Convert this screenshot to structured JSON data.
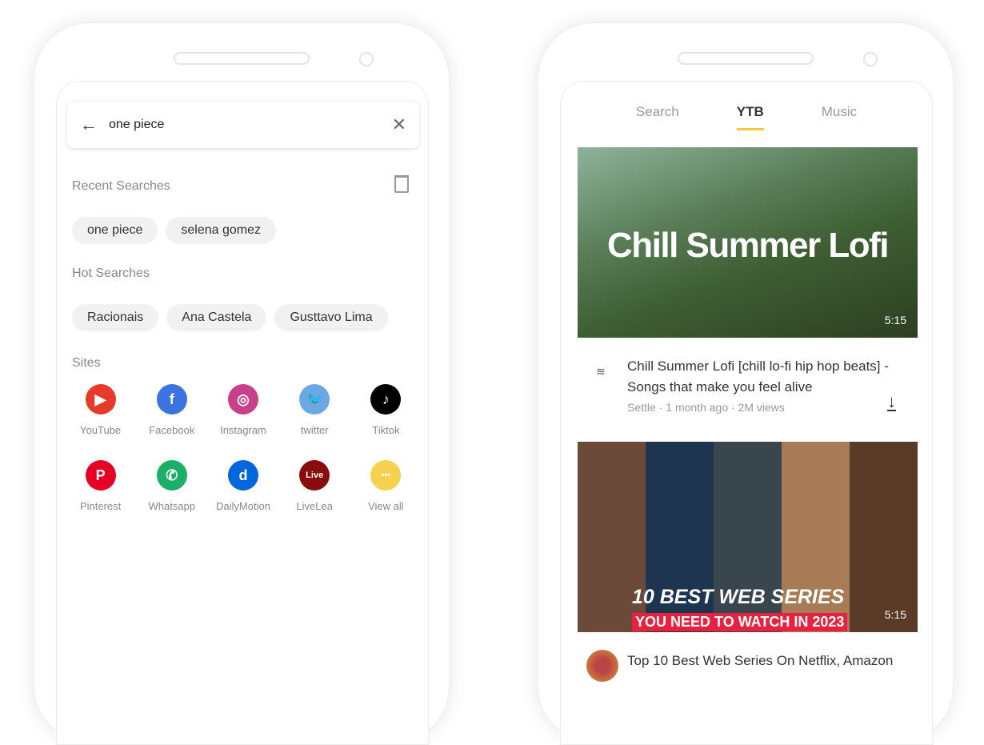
{
  "left": {
    "search_query": "one piece",
    "recent_title": "Recent Searches",
    "recent": [
      "one piece",
      "selena gomez"
    ],
    "hot_title": "Hot Searches",
    "hot": [
      "Racionais",
      "Ana Castela",
      "Gusttavo Lima"
    ],
    "sites_title": "Sites",
    "sites": [
      {
        "label": "YouTube",
        "color": "#e83a2a",
        "glyph": "▶"
      },
      {
        "label": "Facebook",
        "color": "#3b73e0",
        "glyph": "f"
      },
      {
        "label": "Instagram",
        "color": "#c83f8a",
        "glyph": "◎"
      },
      {
        "label": "twitter",
        "color": "#6aa9e6",
        "glyph": "🐦"
      },
      {
        "label": "Tiktok",
        "color": "#000000",
        "glyph": "♪"
      },
      {
        "label": "Pinterest",
        "color": "#e60023",
        "glyph": "P"
      },
      {
        "label": "Whatsapp",
        "color": "#1aae66",
        "glyph": "✆"
      },
      {
        "label": "DailyMotion",
        "color": "#0066dc",
        "glyph": "d"
      },
      {
        "label": "LiveLea",
        "color": "#8a0c0c",
        "glyph": "Live"
      },
      {
        "label": "View all",
        "color": "#f8d04f",
        "glyph": "•••"
      }
    ]
  },
  "right": {
    "tabs": [
      "Search",
      "YTB",
      "Music"
    ],
    "active_tab": "YTB",
    "video1": {
      "thumb_text": "Chill Summer Lofi",
      "duration": "5:15",
      "title": "Chill Summer Lofi [chill lo-fi hip hop beats] - Songs that make you feel alive",
      "channel": "Settle",
      "age": "1 month ago",
      "views": "2M views"
    },
    "video2": {
      "thumb_line1": "10 BEST WEB SERIES",
      "thumb_line2": "YOU NEED TO WATCH IN 2023",
      "duration": "5:15",
      "title": "Top 10 Best Web Series On Netflix, Amazon"
    }
  }
}
